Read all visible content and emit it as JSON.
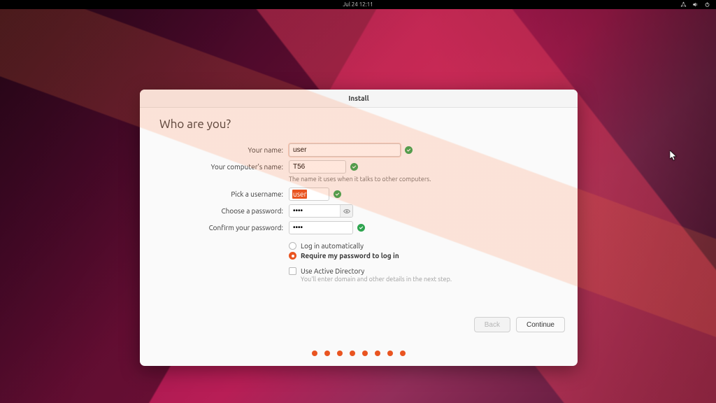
{
  "panel": {
    "datetime": "Jul 24  12:11"
  },
  "window": {
    "title": "Install"
  },
  "page": {
    "heading": "Who are you?"
  },
  "form": {
    "name_label": "Your name:",
    "name_value": "user",
    "computer_label": "Your computer's name:",
    "computer_value": "T56",
    "computer_hint": "The name it uses when it talks to other computers.",
    "username_label": "Pick a username:",
    "username_value": "user",
    "password_label": "Choose a password:",
    "password_value": "••••",
    "confirm_label": "Confirm your password:",
    "confirm_value": "••••",
    "opt_auto": "Log in automatically",
    "opt_require": "Require my password to log in",
    "opt_ad": "Use Active Directory",
    "ad_hint": "You'll enter domain and other details in the next step."
  },
  "buttons": {
    "back": "Back",
    "continue": "Continue"
  },
  "progress": {
    "total": 8
  }
}
